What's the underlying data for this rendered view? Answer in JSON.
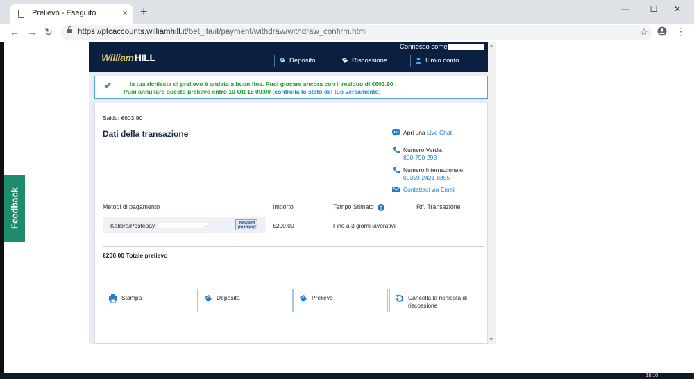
{
  "browser": {
    "tab_title": "Prelievo - Eseguito",
    "tab_close": "×",
    "new_tab": "+",
    "url_host": "https://ptcaccounts.williamhill.it",
    "url_path": "/bet_ita/it/payment/withdraw/withdraw_confirm.html",
    "win_min": "—",
    "win_max": "☐",
    "win_close": "✕",
    "back": "←",
    "forward": "→",
    "reload": "↻",
    "star": "☆",
    "menu": "⋮"
  },
  "feedback": {
    "label": "Feedback"
  },
  "header": {
    "logo_script": "William",
    "logo_bold": "HILL",
    "connected_as": "Connesso come",
    "nav": [
      {
        "label": "Deposito"
      },
      {
        "label": "Riscossione"
      },
      {
        "label": "Il mio conto"
      }
    ]
  },
  "success": {
    "line1": "la tua richiesta di prelievo è andata a buon fine. Puoi giocare ancora con il residuo di €603.90 .",
    "line2_pre": "Puoi annullare questo prelievo entro 10 Ott 18 00:00 (",
    "line2_link": "controlla lo stato del tuo versamento",
    "line2_post": ")"
  },
  "panel": {
    "saldo": "Saldo: €603.90",
    "title": "Dati della transazione",
    "contacts": {
      "chat_pre": "Apri una ",
      "chat_link": "Live Chat",
      "verde_label": "Numero Verde:",
      "verde_number": "800-790-293",
      "intl_label": "Numero Internazionale:",
      "intl_number": "00359-2421-8355",
      "email": "Contattaci via Email"
    },
    "table": {
      "headers": [
        "Metodi di pagamento",
        "Importo",
        "Tempo Stimato",
        "Rif. Transazione"
      ],
      "row": {
        "method": "Kalibra/Postepay",
        "method_suffix": ",",
        "badge_top": "KALIBRA",
        "badge_bottom": "postepay",
        "amount": "€200.00",
        "time": "Fino a 3 giorni lavorativi",
        "ref": ""
      }
    },
    "total": "€200.00 Totale prelievo",
    "actions": [
      {
        "label": "Stampa"
      },
      {
        "label": "Deposita"
      },
      {
        "label": "Prelievo"
      },
      {
        "label": "Cancella la richiesta di riscossione"
      }
    ]
  },
  "taskbar": {
    "clock": "18:10"
  },
  "colors": {
    "header_bg": "#0b1f40",
    "success_green": "#1f9d2b",
    "link_blue": "#1f7fcf",
    "feedback_green": "#1e8a6e"
  }
}
